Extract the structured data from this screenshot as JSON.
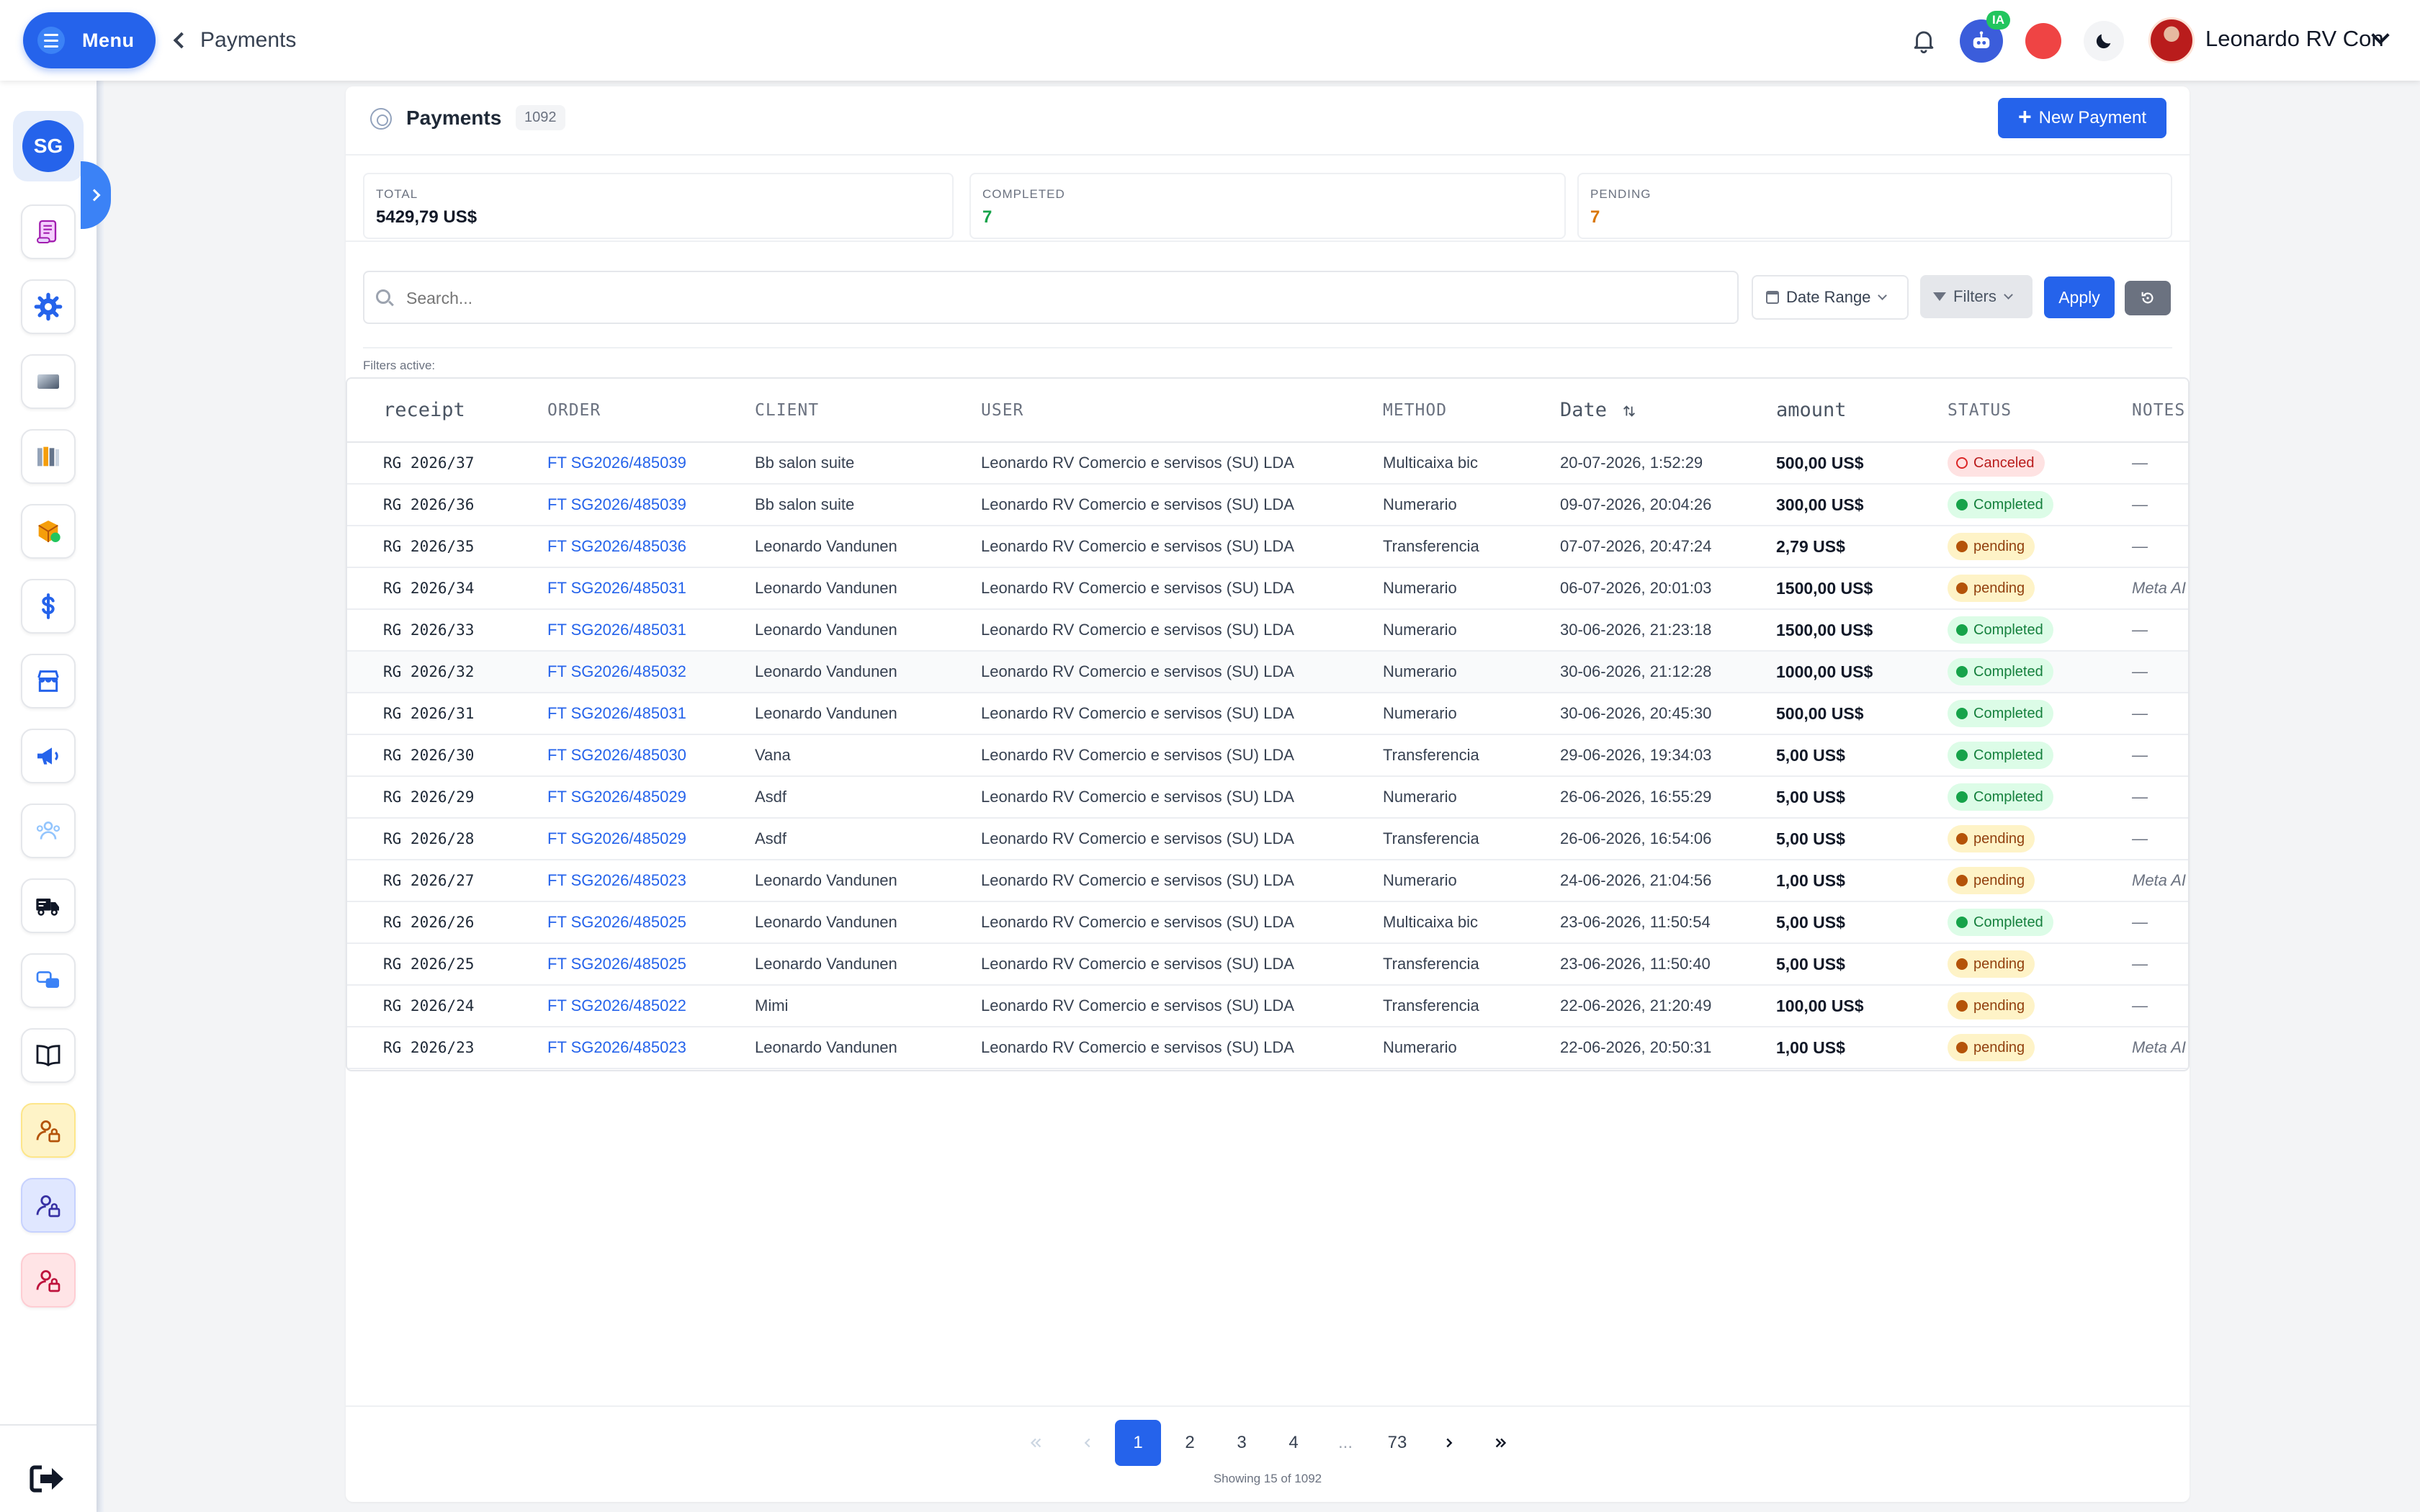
{
  "topbar": {
    "menu_label": "Menu",
    "breadcrumb": "Payments",
    "ai_badge": "IA",
    "user_name": "Leonardo RV Con"
  },
  "sidebar": {
    "company_initials": "SG",
    "items": [
      "scroll-icon",
      "gear-icon",
      "window-icon",
      "books-icon",
      "cube-icon",
      "dollar-icon",
      "store-icon",
      "megaphone-icon",
      "team-icon",
      "truck-icon",
      "chat-icon",
      "book-icon",
      "user-lock-yellow-icon",
      "user-lock-blue-icon",
      "user-lock-pink-icon"
    ]
  },
  "page": {
    "title": "Payments",
    "count": "1092",
    "new_button": "New Payment"
  },
  "stats": {
    "total_label": "TOTAL",
    "total_value": "5429,79 US$",
    "completed_label": "COMPLETED",
    "completed_value": "7",
    "pending_label": "PENDING",
    "pending_value": "7"
  },
  "filters": {
    "search_placeholder": "Search...",
    "date_range": "Date Range",
    "filters": "Filters",
    "apply": "Apply",
    "active_label": "Filters active:"
  },
  "table": {
    "columns": {
      "receipt": "receipt",
      "order": "ORDER",
      "client": "CLIENT",
      "user": "USER",
      "method": "METHOD",
      "date": "Date",
      "amount": "amount",
      "status": "STATUS",
      "notes": "NOTES"
    },
    "rows": [
      {
        "receipt": "RG 2026/37",
        "order": "FT SG2026/485039",
        "client": "Bb salon suite",
        "user": "Leonardo RV Comercio e servisos (SU) LDA",
        "method": "Multicaixa bic",
        "date": "20-07-2026, 1:52:29",
        "amount": "500,00 US$",
        "status": "Canceled",
        "notes": "—"
      },
      {
        "receipt": "RG 2026/36",
        "order": "FT SG2026/485039",
        "client": "Bb salon suite",
        "user": "Leonardo RV Comercio e servisos (SU) LDA",
        "method": "Numerario",
        "date": "09-07-2026, 20:04:26",
        "amount": "300,00 US$",
        "status": "Completed",
        "notes": "—"
      },
      {
        "receipt": "RG 2026/35",
        "order": "FT SG2026/485036",
        "client": "Leonardo Vandunen",
        "user": "Leonardo RV Comercio e servisos (SU) LDA",
        "method": "Transferencia",
        "date": "07-07-2026, 20:47:24",
        "amount": "2,79 US$",
        "status": "pending",
        "notes": "—"
      },
      {
        "receipt": "RG 2026/34",
        "order": "FT SG2026/485031",
        "client": "Leonardo Vandunen",
        "user": "Leonardo RV Comercio e servisos (SU) LDA",
        "method": "Numerario",
        "date": "06-07-2026, 20:01:03",
        "amount": "1500,00 US$",
        "status": "pending",
        "notes": "Meta AI"
      },
      {
        "receipt": "RG 2026/33",
        "order": "FT SG2026/485031",
        "client": "Leonardo Vandunen",
        "user": "Leonardo RV Comercio e servisos (SU) LDA",
        "method": "Numerario",
        "date": "30-06-2026, 21:23:18",
        "amount": "1500,00 US$",
        "status": "Completed",
        "notes": "—"
      },
      {
        "receipt": "RG 2026/32",
        "order": "FT SG2026/485032",
        "client": "Leonardo Vandunen",
        "user": "Leonardo RV Comercio e servisos (SU) LDA",
        "method": "Numerario",
        "date": "30-06-2026, 21:12:28",
        "amount": "1000,00 US$",
        "status": "Completed",
        "notes": "—"
      },
      {
        "receipt": "RG 2026/31",
        "order": "FT SG2026/485031",
        "client": "Leonardo Vandunen",
        "user": "Leonardo RV Comercio e servisos (SU) LDA",
        "method": "Numerario",
        "date": "30-06-2026, 20:45:30",
        "amount": "500,00 US$",
        "status": "Completed",
        "notes": "—"
      },
      {
        "receipt": "RG 2026/30",
        "order": "FT SG2026/485030",
        "client": "Vana",
        "user": "Leonardo RV Comercio e servisos (SU) LDA",
        "method": "Transferencia",
        "date": "29-06-2026, 19:34:03",
        "amount": "5,00 US$",
        "status": "Completed",
        "notes": "—"
      },
      {
        "receipt": "RG 2026/29",
        "order": "FT SG2026/485029",
        "client": "Asdf",
        "user": "Leonardo RV Comercio e servisos (SU) LDA",
        "method": "Numerario",
        "date": "26-06-2026, 16:55:29",
        "amount": "5,00 US$",
        "status": "Completed",
        "notes": "—"
      },
      {
        "receipt": "RG 2026/28",
        "order": "FT SG2026/485029",
        "client": "Asdf",
        "user": "Leonardo RV Comercio e servisos (SU) LDA",
        "method": "Transferencia",
        "date": "26-06-2026, 16:54:06",
        "amount": "5,00 US$",
        "status": "pending",
        "notes": "—"
      },
      {
        "receipt": "RG 2026/27",
        "order": "FT SG2026/485023",
        "client": "Leonardo Vandunen",
        "user": "Leonardo RV Comercio e servisos (SU) LDA",
        "method": "Numerario",
        "date": "24-06-2026, 21:04:56",
        "amount": "1,00 US$",
        "status": "pending",
        "notes": "Meta AI"
      },
      {
        "receipt": "RG 2026/26",
        "order": "FT SG2026/485025",
        "client": "Leonardo Vandunen",
        "user": "Leonardo RV Comercio e servisos (SU) LDA",
        "method": "Multicaixa bic",
        "date": "23-06-2026, 11:50:54",
        "amount": "5,00 US$",
        "status": "Completed",
        "notes": "—"
      },
      {
        "receipt": "RG 2026/25",
        "order": "FT SG2026/485025",
        "client": "Leonardo Vandunen",
        "user": "Leonardo RV Comercio e servisos (SU) LDA",
        "method": "Transferencia",
        "date": "23-06-2026, 11:50:40",
        "amount": "5,00 US$",
        "status": "pending",
        "notes": "—"
      },
      {
        "receipt": "RG 2026/24",
        "order": "FT SG2026/485022",
        "client": "Mimi",
        "user": "Leonardo RV Comercio e servisos (SU) LDA",
        "method": "Transferencia",
        "date": "22-06-2026, 21:20:49",
        "amount": "100,00 US$",
        "status": "pending",
        "notes": "—"
      },
      {
        "receipt": "RG 2026/23",
        "order": "FT SG2026/485023",
        "client": "Leonardo Vandunen",
        "user": "Leonardo RV Comercio e servisos (SU) LDA",
        "method": "Numerario",
        "date": "22-06-2026, 20:50:31",
        "amount": "1,00 US$",
        "status": "pending",
        "notes": "Meta AI"
      }
    ]
  },
  "pagination": {
    "pages": [
      "1",
      "2",
      "3",
      "4",
      "...",
      "73"
    ],
    "current": "1",
    "showing": "Showing 15 of 1092"
  },
  "colors": {
    "primary": "#2563eb",
    "completed": "#16a34a",
    "pending": "#d97706",
    "canceled": "#dc2626"
  }
}
